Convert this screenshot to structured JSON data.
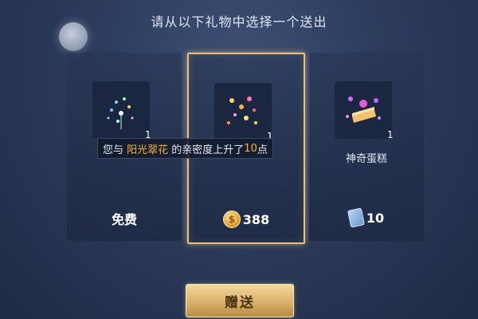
{
  "header": {
    "title": "请从以下礼物中选择一个送出"
  },
  "gifts": [
    {
      "name": "",
      "quantity": "1",
      "price_label": "免费",
      "currency_icon": "",
      "selected": false
    },
    {
      "name": "",
      "quantity": "1",
      "price_label": "388",
      "currency_icon": "gold-coin-icon",
      "selected": true
    },
    {
      "name": "神奇蛋糕",
      "quantity": "1",
      "price_label": "10",
      "currency_icon": "ticket-icon",
      "selected": false
    }
  ],
  "toast": {
    "prefix": "您与 ",
    "friend_name": "阳光翠花",
    "middle": " 的亲密度上升了",
    "amount": "10",
    "suffix": "点"
  },
  "send_button": {
    "label": "赠送"
  },
  "colors": {
    "accent_gold": "#e8c27a",
    "highlight": "#f3b43a",
    "background": "#2c3b5c"
  }
}
